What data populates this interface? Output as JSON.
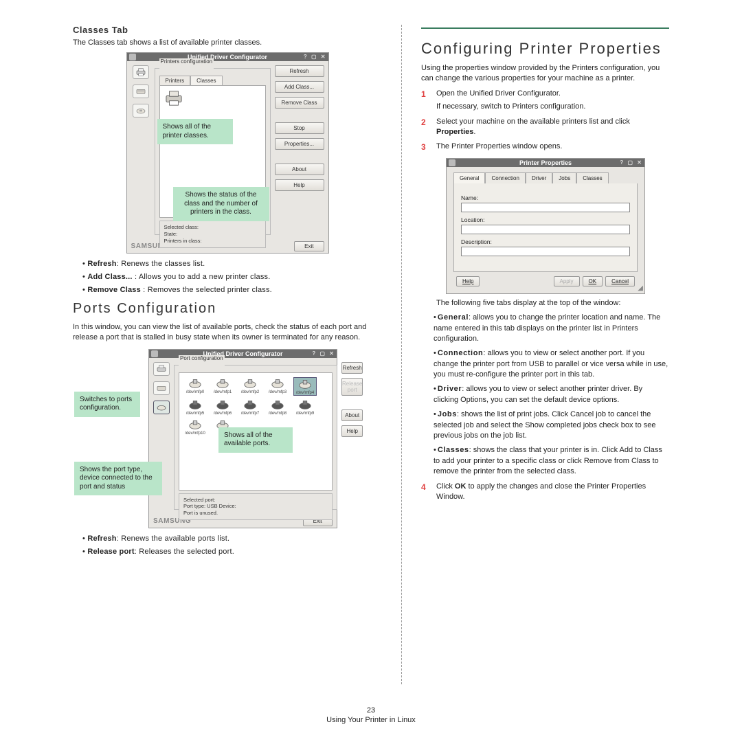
{
  "left": {
    "classesTab_heading": "Classes Tab",
    "classesTab_intro": "The Classes tab shows a list of available printer classes.",
    "fig1": {
      "window_title": "Unified Driver Configurator",
      "group_label": "Printers configuration",
      "tab_printers": "Printers",
      "tab_classes": "Classes",
      "buttons": {
        "refresh": "Refresh",
        "add_class": "Add Class...",
        "remove_class": "Remove Class",
        "stop": "Stop",
        "properties": "Properties...",
        "about": "About",
        "help": "Help"
      },
      "selected_box": {
        "title": "Selected class:",
        "state": "State:",
        "printers": "Printers in class:"
      },
      "brand": "SAMSUNG",
      "exit": "Exit",
      "callout_left": "Shows all of the printer classes.",
      "callout_right": "Shows the status of the class and the number of printers in the class."
    },
    "classes_notes": [
      {
        "term": "Refresh",
        "text": ": Renews the classes list."
      },
      {
        "term": "Add Class...",
        "text": " : Allows you to add a new printer class."
      },
      {
        "term": "Remove Class",
        "text": " : Removes the selected printer class."
      }
    ],
    "ports_heading": "Ports Configuration",
    "ports_intro": "In this window, you can view the list of available ports, check the status of each port and release a port that is stalled in busy state when its owner is terminated for any reason.",
    "fig2": {
      "window_title": "Unified Driver Configurator",
      "group_label": "Port configuration",
      "buttons": {
        "refresh": "Refresh",
        "release": "Release port",
        "about": "About",
        "help": "Help"
      },
      "port_labels": [
        "/dev/mfp0",
        "/dev/mfp1",
        "/dev/mfp2",
        "/dev/mfp3",
        "/dev/mfp4",
        "/dev/mfp5",
        "/dev/mfp6",
        "/dev/mfp7",
        "/dev/mfp8",
        "/dev/mfp9",
        "/dev/mfp10",
        ""
      ],
      "selected_box": {
        "title": "Selected port:",
        "type": "Port type: USB   Device:",
        "status": "Port is unused."
      },
      "brand": "SAMSUNG",
      "exit": "Exit",
      "callout_a": "Switches to ports configuration.",
      "callout_b": "Shows all of the available ports.",
      "callout_c": "Shows the port type, device connected to the port and status"
    },
    "ports_notes": [
      {
        "term": "Refresh",
        "text": ": Renews the available ports list."
      },
      {
        "term": "Release port",
        "text": ": Releases the selected port."
      }
    ]
  },
  "right": {
    "heading": "Configuring Printer Properties",
    "intro": "Using the properties window provided by the Printers configuration, you can change the various properties for your machine as a printer.",
    "steps": {
      "s1a": "Open the Unified Driver Configurator.",
      "s1b": "If necessary, switch to Printers configuration.",
      "s2a": "Select your machine on the available printers list and click ",
      "s2b": "Properties",
      "s2c": ".",
      "s3": "The Printer Properties window opens."
    },
    "fig3": {
      "window_title": "Printer Properties",
      "tabs": [
        "General",
        "Connection",
        "Driver",
        "Jobs",
        "Classes"
      ],
      "labels": {
        "name": "Name:",
        "location": "Location:",
        "description": "Description:"
      },
      "buttons": {
        "help": "Help",
        "apply": "Apply",
        "ok": "OK",
        "cancel": "Cancel"
      }
    },
    "afterfig": "The following five tabs display at the top of the window:",
    "tabdesc": [
      {
        "term": "General",
        "text": ": allows you to change the printer location and name. The name entered in this tab displays on the printer list in Printers configuration."
      },
      {
        "term": "Connection",
        "text": ": allows you to view or select another port. If you change the printer port from USB to parallel or vice versa while in use, you must re-configure the printer port in this tab."
      },
      {
        "term": "Driver",
        "text": ": allows you to view or select another printer driver. By clicking Options, you can set the default device options."
      },
      {
        "term": "Jobs",
        "text": ": shows the list of print jobs. Click Cancel job to cancel the selected job and select the Show completed jobs check box to see previous jobs on the job list."
      },
      {
        "term": "Classes",
        "text": ": shows the class that your printer is in. Click Add to Class to add your printer to a specific class or click Remove from Class to remove the printer from the selected class."
      }
    ],
    "step4a": "Click ",
    "step4b": "OK",
    "step4c": " to apply the changes and close the Printer Properties Window."
  },
  "footer": {
    "page": "23",
    "caption": "Using Your Printer in Linux"
  }
}
